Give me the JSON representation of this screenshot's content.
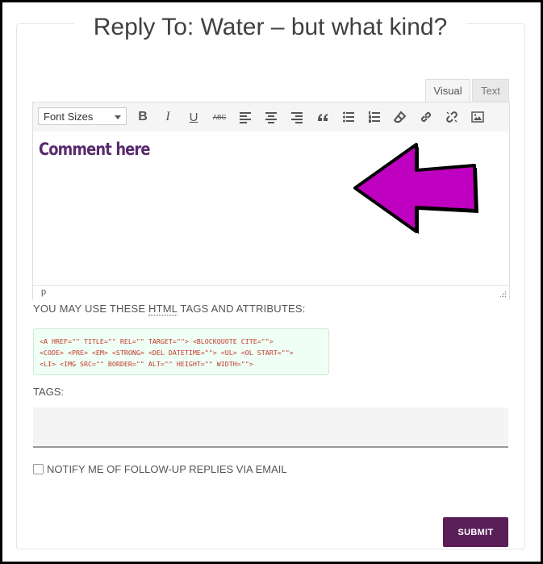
{
  "page": {
    "title": "Reply To: Water – but what kind?"
  },
  "editor": {
    "tabs": [
      {
        "label": "Visual"
      },
      {
        "label": "Text"
      }
    ],
    "font_sizes_label": "Font Sizes",
    "toolbar_icons": [
      "bold-icon",
      "italic-icon",
      "underline-icon",
      "strikethrough-icon",
      "align-left-icon",
      "align-center-icon",
      "align-right-icon",
      "blockquote-icon",
      "bulleted-list-icon",
      "numbered-list-icon",
      "eraser-icon",
      "link-icon",
      "unlink-icon",
      "image-icon"
    ],
    "toolbar_glyphs": {
      "bold": "B",
      "italic": "I",
      "underline": "U",
      "strike": "ABC"
    },
    "placeholder_text": "Comment here",
    "arrow_color": "#c000c0",
    "path": "p"
  },
  "allowed_tags": {
    "label_prefix": "YOU MAY USE THESE ",
    "label_abbr": "HTML",
    "label_suffix": " TAGS AND ATTRIBUTES:",
    "lines": [
      "<A HREF=\"\" TITLE=\"\" REL=\"\" TARGET=\"\"> <BLOCKQUOTE CITE=\"\">",
      "<CODE> <PRE> <EM> <STRONG> <DEL DATETIME=\"\"> <UL> <OL START=\"\">",
      "<LI> <IMG SRC=\"\" BORDER=\"\" ALT=\"\" HEIGHT=\"\" WIDTH=\"\">"
    ]
  },
  "tags": {
    "label": "TAGS:",
    "value": ""
  },
  "notify": {
    "label": "NOTIFY ME OF FOLLOW-UP REPLIES VIA EMAIL"
  },
  "submit": {
    "label": "SUBMIT",
    "color": "#5a1f58"
  }
}
